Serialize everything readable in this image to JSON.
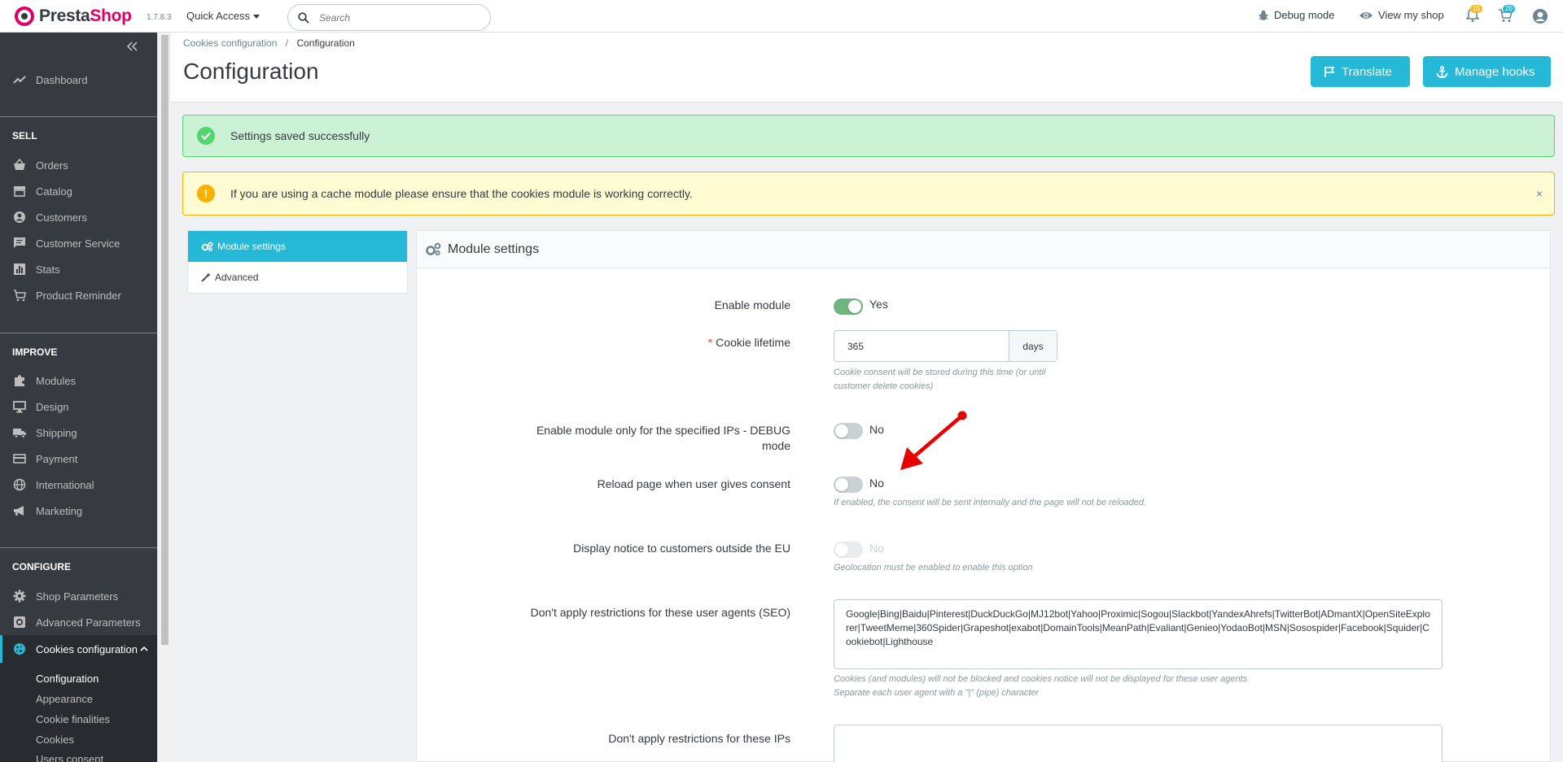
{
  "header": {
    "brand_prefix": "Presta",
    "brand_suffix": "Shop",
    "version": "1.7.8.3",
    "quick_access": "Quick Access",
    "search_placeholder": "Search",
    "debug_mode": "Debug mode",
    "view_shop": "View my shop",
    "notif_count": "15",
    "orders_count": "20"
  },
  "sidebar": {
    "dashboard": "Dashboard",
    "sell": "SELL",
    "orders": "Orders",
    "catalog": "Catalog",
    "customers": "Customers",
    "customer_service": "Customer Service",
    "stats": "Stats",
    "product_reminder": "Product Reminder",
    "improve": "IMPROVE",
    "modules": "Modules",
    "design": "Design",
    "shipping": "Shipping",
    "payment": "Payment",
    "international": "International",
    "marketing": "Marketing",
    "configure": "CONFIGURE",
    "shop_parameters": "Shop Parameters",
    "advanced_parameters": "Advanced Parameters",
    "cookies_configuration": "Cookies configuration",
    "sub": {
      "configuration": "Configuration",
      "appearance": "Appearance",
      "cookie_finalities": "Cookie finalities",
      "cookies": "Cookies",
      "users_consent": "Users consent"
    }
  },
  "page": {
    "breadcrumb_parent": "Cookies configuration",
    "breadcrumb_sep": "/",
    "breadcrumb_current": "Configuration",
    "title": "Configuration",
    "translate_btn": "Translate",
    "manage_hooks_btn": "Manage hooks"
  },
  "alerts": {
    "success": "Settings saved successfully",
    "warning": "If you are using a cache module please ensure that the cookies module is working correctly.",
    "close": "×"
  },
  "tabs": {
    "module_settings": "Module settings",
    "advanced": "Advanced"
  },
  "panel": {
    "title": "Module settings",
    "enable_module_label": "Enable module",
    "enable_module_value": "Yes",
    "cookie_lifetime_label": "Cookie lifetime",
    "cookie_lifetime_required": "*",
    "cookie_lifetime_value": "365",
    "cookie_lifetime_unit": "days",
    "cookie_lifetime_help": "Cookie consent will be stored during this time (or until customer delete cookies)",
    "debug_label": "Enable module only for the specified IPs - DEBUG mode",
    "debug_value": "No",
    "reload_label": "Reload page when user gives consent",
    "reload_value": "No",
    "reload_help": "If enabled, the consent will be sent internally and the page will not be reloaded.",
    "outside_eu_label": "Display notice to customers outside the EU",
    "outside_eu_value": "No",
    "outside_eu_help": "Geolocation must be enabled to enable this option",
    "user_agents_label": "Don't apply restrictions for these user agents (SEO)",
    "user_agents_value": "Google|Bing|Baidu|Pinterest|DuckDuckGo|MJ12bot|Yahoo|Proximic|Sogou|Slackbot|YandexAhrefs|TwitterBot|ADmantX|OpenSiteExplorer|TweetMeme|360Spider|Grapeshot|exabot|DomainTools|MeanPath|Evaliant|Genieo|YodaoBot|MSN|Sosospider|Facebook|Squider|Cookiebot|Lighthouse",
    "user_agents_help_1": "Cookies (and modules) will not be blocked and cookies notice will not be displayed for these user agents",
    "user_agents_help_2": "Separate each user agent with a \"|\" (pipe) character",
    "ips_label": "Don't apply restrictions for these IPs",
    "ips_value": ""
  },
  "colors": {
    "accent": "#25b9d7",
    "sidebar_bg": "#363a41",
    "success_bg": "#cbf2d4",
    "warning_bg": "#fffbd3",
    "arrow": "#e60000",
    "switch_on": "#70b580"
  }
}
